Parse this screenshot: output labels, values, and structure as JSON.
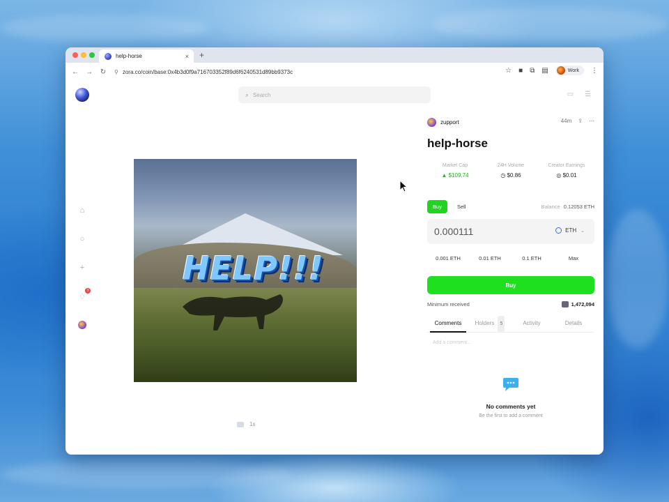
{
  "browser": {
    "tab_title": "help-horse",
    "tab_close": "×",
    "new_tab": "+",
    "url": "zora.co/coin/base:0x4b3d0f9a716703352f89d6f6240531d89bb9373c",
    "profile_label": "Work",
    "colors": {
      "close": "#ff5f57",
      "minimize": "#febc2e",
      "zoom": "#28c840"
    }
  },
  "header": {
    "search_placeholder": "Search"
  },
  "sidebar": {
    "notification_count": "3"
  },
  "media": {
    "overlay_text": "HELP!!!",
    "meta_text": "1s"
  },
  "coin": {
    "creator": "zupport",
    "age": "44m",
    "title": "help-horse",
    "stats": [
      {
        "label": "Market Cap",
        "value": "$109.74",
        "icon": "up-triangle-icon"
      },
      {
        "label": "24H Volume",
        "value": "$0.86",
        "icon": "stopwatch-icon"
      },
      {
        "label": "Creator Earnings",
        "value": "$0.01",
        "icon": "coins-icon"
      }
    ]
  },
  "trade": {
    "buy_tab": "Buy",
    "sell_tab": "Sell",
    "balance_label": "Balance",
    "balance_value": "0.12053 ETH",
    "amount": "0.000111",
    "currency": "ETH",
    "presets": [
      "0.001 ETH",
      "0.01 ETH",
      "0.1 ETH",
      "Max"
    ],
    "buy_button": "Buy",
    "min_received_label": "Minimum received",
    "min_received_value": "1,472,094",
    "accent_color": "#1fe01f"
  },
  "comments": {
    "tabs": [
      {
        "label": "Comments"
      },
      {
        "label": "Holders",
        "count": "5"
      },
      {
        "label": "Activity"
      },
      {
        "label": "Details"
      }
    ],
    "placeholder": "Add a comment...",
    "empty_title": "No comments yet",
    "empty_subtitle": "Be the first to add a comment"
  }
}
